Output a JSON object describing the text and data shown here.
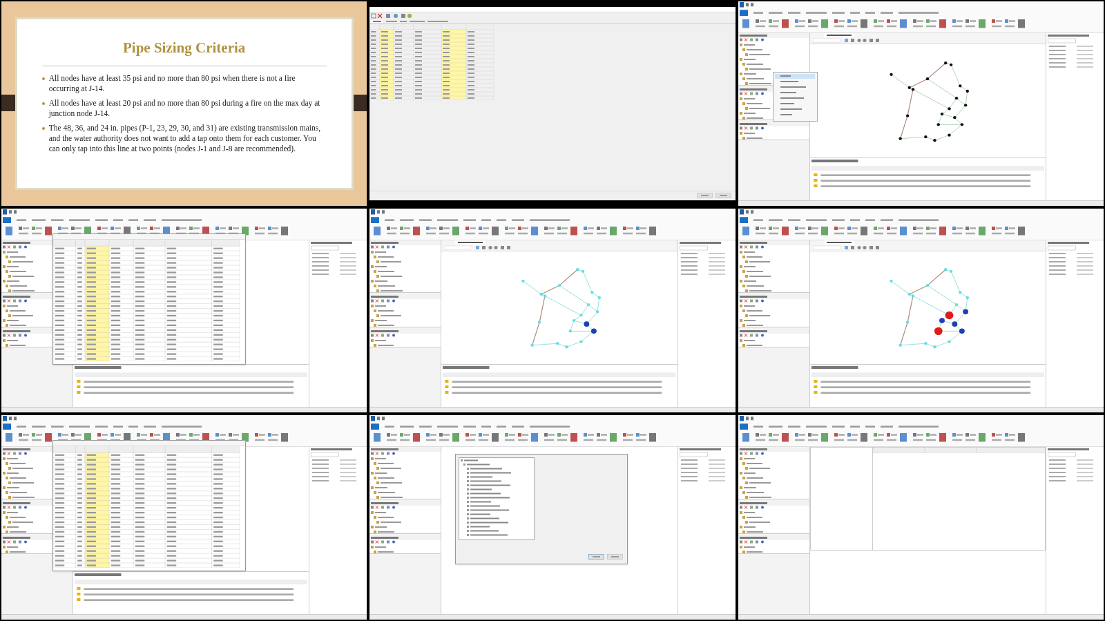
{
  "tiles": [
    {
      "kind": "slide",
      "title": "Pipe Sizing Criteria",
      "bullets": [
        "All nodes have at least 35 psi and no more than 80 psi when there is not a fire occurring at J-14.",
        "All nodes have at least 20 psi and no more than 80 psi during a fire on the max day at junction node J-14.",
        "The 48, 36, and 24 in. pipes (P-1, 23, 29, 30, and 31) are existing transmission mains, and the water authority does not want to add a tap onto them for each customer. You can only tap into this line at two points (nodes J-1 and J-8 are recommended)."
      ]
    },
    {
      "kind": "flex_table"
    },
    {
      "kind": "app_network_plain",
      "context_menu_open": true
    },
    {
      "kind": "app_table_dialog"
    },
    {
      "kind": "app_network_query"
    },
    {
      "kind": "app_network_fire"
    },
    {
      "kind": "app_table_dialog"
    },
    {
      "kind": "app_library_dialog"
    },
    {
      "kind": "app_design_study"
    }
  ]
}
